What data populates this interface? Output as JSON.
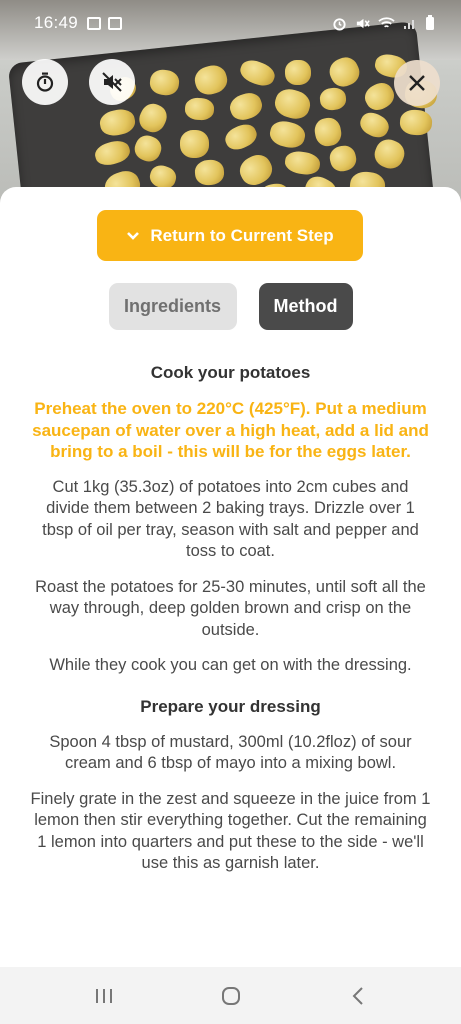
{
  "status_bar": {
    "time": "16:49"
  },
  "hero": {
    "image_icon": "roasted-potatoes-photo"
  },
  "controls": {
    "timer_icon": "timer-icon",
    "mute_icon": "sound-off-icon",
    "close_icon": "close-icon"
  },
  "return_button": {
    "label": "Return to Current Step"
  },
  "tabs": [
    {
      "label": "Ingredients",
      "active": false
    },
    {
      "label": "Method",
      "active": true
    }
  ],
  "steps": [
    {
      "title": "Cook your potatoes",
      "highlight": "Preheat the oven to 220°C (425°F). Put a medium saucepan of water over a high heat, add a lid and bring to a boil - this will be for the eggs later.",
      "paragraphs": [
        "Cut 1kg (35.3oz) of potatoes into 2cm cubes and divide them between 2 baking trays. Drizzle over 1 tbsp of oil per tray, season with salt and pepper and toss to coat.",
        "Roast the potatoes for 25-30 minutes, until soft all the way through, deep golden brown and crisp on the outside.",
        "While they cook you can get on with the dressing."
      ]
    },
    {
      "title": "Prepare your dressing",
      "paragraphs": [
        "Spoon 4 tbsp of mustard, 300ml (10.2floz) of sour cream and 6 tbsp of mayo into a mixing bowl.",
        "Finely grate in the zest and squeeze in the juice from 1 lemon then stir everything together. Cut the remaining 1 lemon into quarters and put these to the side - we'll use this as garnish later."
      ]
    }
  ],
  "colors": {
    "accent": "#f9b414",
    "tab_active_bg": "#4a4a4a",
    "tab_inactive_bg": "#e2e2e2"
  }
}
